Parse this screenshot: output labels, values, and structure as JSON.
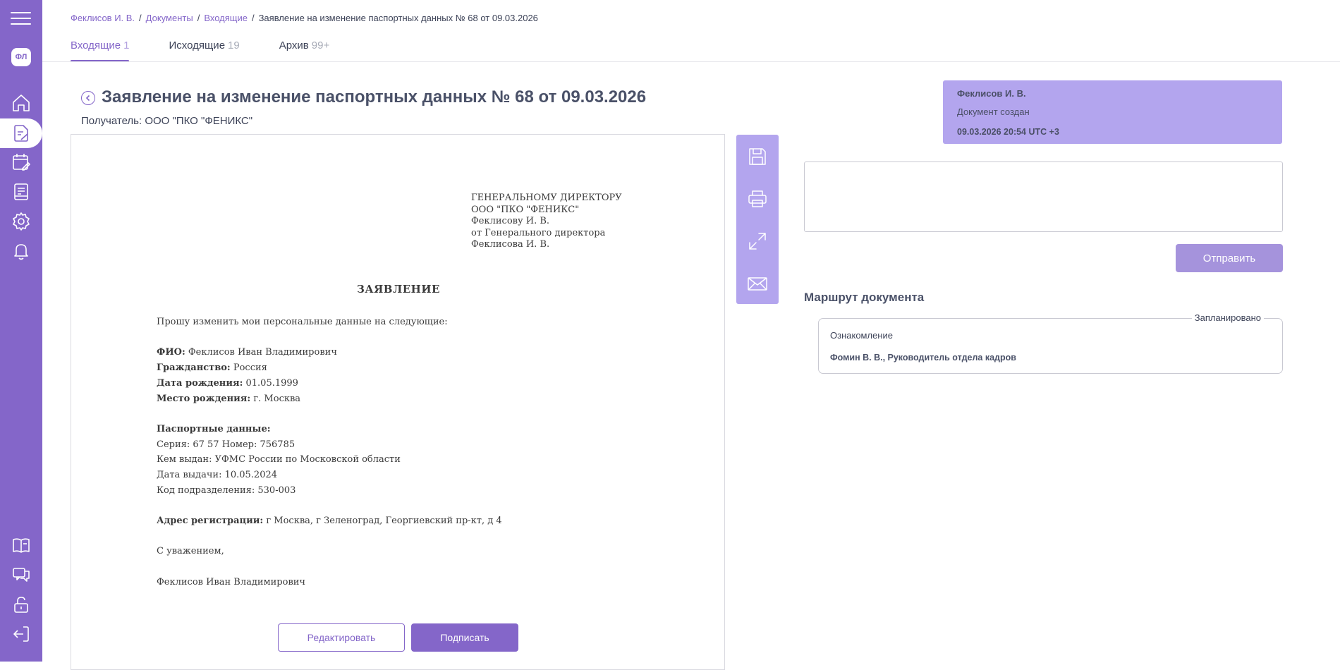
{
  "sidebar": {
    "avatar": "ФЛ",
    "top_items": [
      "home-icon",
      "documents-icon",
      "calendar-edit-icon",
      "report-icon",
      "gear-icon",
      "bell-icon"
    ],
    "bottom_items": [
      "book-icon",
      "chat-icon",
      "unlock-icon",
      "logout-icon"
    ],
    "accent": "#8466c9"
  },
  "breadcrumb": {
    "items": [
      "Феклисов И. В.",
      "Документы",
      "Входящие"
    ],
    "current": "Заявление на изменение паспортных данных № 68 от 09.03.2026"
  },
  "tabs": [
    {
      "label": "Входящие",
      "count": "1",
      "active": true
    },
    {
      "label": "Исходящие",
      "count": "19",
      "active": false
    },
    {
      "label": "Архив",
      "count": "99+",
      "active": false
    }
  ],
  "page": {
    "title": "Заявление на изменение паспортных данных № 68 от 09.03.2026",
    "recipient": "Получатель: ООО \"ПКО \"ФЕНИКС\""
  },
  "document": {
    "addressee": [
      "ГЕНЕРАЛЬНОМУ ДИРЕКТОРУ",
      "ООО \"ПКО \"ФЕНИКС\"",
      "Феклисову И. В.",
      "от Генерального директора",
      "Феклисова И. В."
    ],
    "heading": "ЗАЯВЛЕНИЕ",
    "intro": "Прошу изменить мои персональные данные на следующие:",
    "fio_label": "ФИО:",
    "fio_value": " Феклисов Иван Владимирович",
    "citizenship_label": "Гражданство:",
    "citizenship_value": " Россия",
    "birthdate_label": "Дата рождения:",
    "birthdate_value": " 01.05.1999",
    "birthplace_label": "Место рождения:",
    "birthplace_value": " г. Москва",
    "passport_label": "Паспортные данные:",
    "passport_series": "Серия: 67 57 Номер: 756785",
    "passport_issued_by": "Кем выдан: УФМС России по Московской области",
    "passport_issue_date": "Дата выдачи: 10.05.2024",
    "passport_division": "Код подразделения: 530-003",
    "address_label": "Адрес регистрации:",
    "address_value": " г Москва, г Зеленоград, Георгиевский пр-кт, д 4",
    "closing": "С уважением,",
    "signature": "Феклисов Иван Владимирович",
    "edit_label": "Редактировать",
    "sign_label": "Подписать"
  },
  "toolbar": [
    "save-icon",
    "print-icon",
    "expand-icon",
    "mail-icon"
  ],
  "event": {
    "author": "Феклисов И. В.",
    "text": "Документ создан",
    "time": "09.03.2026 20:54 UTC +3"
  },
  "comment": {
    "value": ""
  },
  "send_label": "Отправить",
  "route": {
    "title": "Маршрут документа",
    "status": "Запланировано",
    "type": "Ознакомление",
    "person": "Фомин В. В., Руководитель отдела кадров"
  }
}
